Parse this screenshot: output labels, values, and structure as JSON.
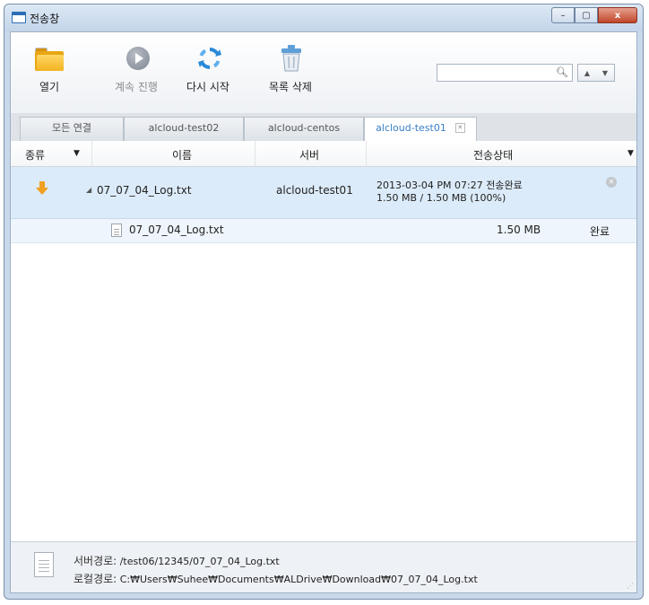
{
  "window": {
    "title": "전송창",
    "minimize": "–",
    "maximize": "▢",
    "close": "x"
  },
  "toolbar": {
    "open_label": "열기",
    "resume_label": "계속 진행",
    "restart_label": "다시 시작",
    "clear_label": "목록 삭제"
  },
  "search": {
    "value": "",
    "placeholder": "",
    "icon": "search-icon"
  },
  "tabs": [
    {
      "label": "모든 연결"
    },
    {
      "label": "alcloud-test02"
    },
    {
      "label": "alcloud-centos"
    },
    {
      "label": "alcloud-test01"
    }
  ],
  "columns": {
    "type": "종류",
    "name": "이름",
    "server": "서버",
    "status": "전송상태"
  },
  "transfers": [
    {
      "name": "07_07_04_Log.txt",
      "server": "alcloud-test01",
      "status_line1": "2013-03-04 PM 07:27 전송완료",
      "status_line2": "1.50 MB / 1.50 MB (100%)",
      "files": [
        {
          "name": "07_07_04_Log.txt",
          "size": "1.50 MB",
          "status": "완료"
        }
      ]
    }
  ],
  "footer": {
    "server_path_label": "서버경로:",
    "server_path": "/test06/12345/07_07_04_Log.txt",
    "local_path_label": "로컬경로:",
    "local_path": "C:₩Users₩Suhee₩Documents₩ALDrive₩Download₩07_07_04_Log.txt"
  },
  "colors": {
    "accent": "#3a7fc8",
    "selected_row": "#dcebf9",
    "folder": "#f2b320",
    "download_arrow": "#f0a020"
  }
}
